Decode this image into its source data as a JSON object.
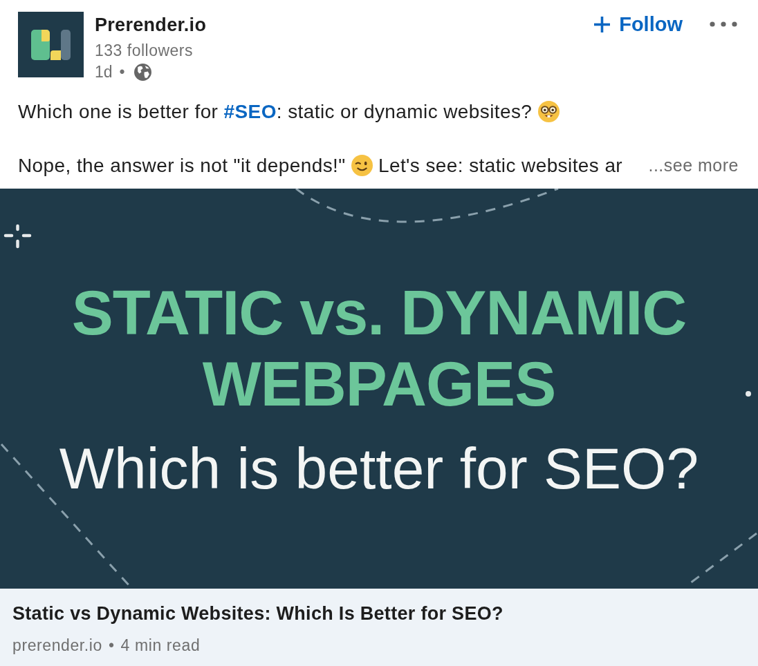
{
  "author": {
    "name": "Prerender.io",
    "followers": "133 followers",
    "age": "1d",
    "separator": "•"
  },
  "follow_button": {
    "label": "Follow"
  },
  "post": {
    "paragraphs": [
      [
        {
          "kind": "text",
          "text": "Which one is better for "
        },
        {
          "kind": "hashtag",
          "text": "#SEO"
        },
        {
          "kind": "text",
          "text": ": static or dynamic websites? "
        },
        {
          "kind": "emoji"
        }
      ],
      [
        {
          "kind": "text",
          "text": "Nope, the answer is not \"it depends!\" "
        },
        {
          "kind": "emoji"
        },
        {
          "kind": "text",
          "text": " Let's see: static websites ar"
        }
      ]
    ],
    "see_more": "...see more"
  },
  "banner": {
    "title_lines": [
      "STATIC vs. DYNAMIC",
      "WEBPAGES"
    ],
    "subtitle": "Which is better for SEO?"
  },
  "link_preview": {
    "title": "Static vs Dynamic Websites: Which Is Better for SEO?",
    "source": "prerender.io",
    "separator": "•",
    "read_time": "4 min read"
  }
}
